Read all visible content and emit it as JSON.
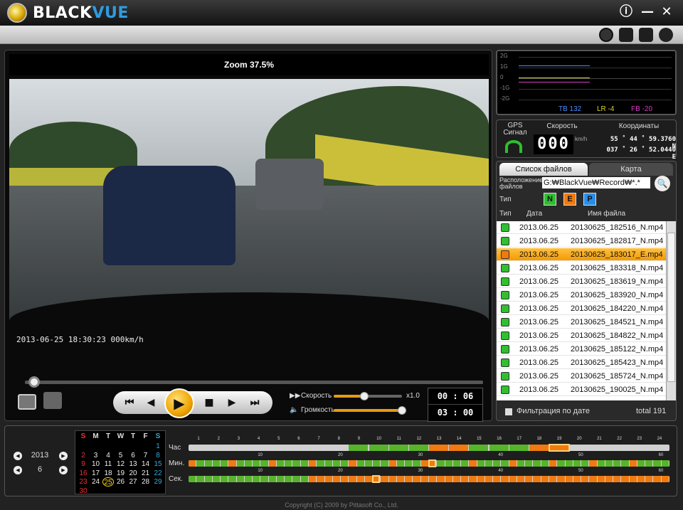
{
  "app": {
    "brand_black": "BLACK",
    "brand_blue": "VUE"
  },
  "window_controls": {
    "info": "ⓘ",
    "minimize": "—",
    "close": "✕"
  },
  "player": {
    "zoom_text": "Zoom 37.5%",
    "osd_text": "2013-06-25 18:30:23  000km/h",
    "seek_progress": 0.02,
    "speed_label": "Скорость",
    "speed_value": "x1.0",
    "speed_level": 0.45,
    "volume_label": "Громкость",
    "volume_level": 1.0,
    "time_current": "00 : 06",
    "time_total": "03 : 00"
  },
  "sensor": {
    "labels": [
      "2G",
      "1G",
      "0",
      "-1G",
      "-2G"
    ],
    "tb_label": "TB 132",
    "lr_label": "LR -4",
    "fb_label": "FB -20",
    "colors": {
      "tb": "#4a8cff",
      "lr": "#d6d62a",
      "fb": "#d040c0"
    }
  },
  "gps": {
    "signal_label": "GPS\nСигнал",
    "speed_label": "Скорость",
    "speed_value": "000",
    "speed_unit": "km/h",
    "coords_label": "Координаты",
    "lat_prefix": "N",
    "lat": "55 ˚ 44 ˚ 59.3760 N",
    "lon_prefix": "E",
    "lon": "037 ˚ 26 ˚ 52.0440 E"
  },
  "files": {
    "tab_list": "Список файлов",
    "tab_map": "Карта",
    "location_label": "Расположение\nфайлов",
    "location_value": "G:₩BlackVue₩Record₩*.*",
    "type_label": "Тип",
    "type_buttons": [
      {
        "label": "N",
        "color": "#2fbf2f"
      },
      {
        "label": "E",
        "color": "#f07a10"
      },
      {
        "label": "P",
        "color": "#2a8ee8"
      }
    ],
    "headers": {
      "type": "Тип",
      "date": "Дата",
      "name": "Имя файла"
    },
    "rows": [
      {
        "date": "2013.06.25",
        "name": "20130625_182516_N.mp4",
        "type": "N"
      },
      {
        "date": "2013.06.25",
        "name": "20130625_182817_N.mp4",
        "type": "N"
      },
      {
        "date": "2013.06.25",
        "name": "20130625_183017_E.mp4",
        "type": "E",
        "selected": true
      },
      {
        "date": "2013.06.25",
        "name": "20130625_183318_N.mp4",
        "type": "N"
      },
      {
        "date": "2013.06.25",
        "name": "20130625_183619_N.mp4",
        "type": "N"
      },
      {
        "date": "2013.06.25",
        "name": "20130625_183920_N.mp4",
        "type": "N"
      },
      {
        "date": "2013.06.25",
        "name": "20130625_184220_N.mp4",
        "type": "N"
      },
      {
        "date": "2013.06.25",
        "name": "20130625_184521_N.mp4",
        "type": "N"
      },
      {
        "date": "2013.06.25",
        "name": "20130625_184822_N.mp4",
        "type": "N"
      },
      {
        "date": "2013.06.25",
        "name": "20130625_185122_N.mp4",
        "type": "N"
      },
      {
        "date": "2013.06.25",
        "name": "20130625_185423_N.mp4",
        "type": "N"
      },
      {
        "date": "2013.06.25",
        "name": "20130625_185724_N.mp4",
        "type": "N"
      },
      {
        "date": "2013.06.25",
        "name": "20130625_190025_N.mp4",
        "type": "N"
      }
    ],
    "filter_label": "Фильтрация по дате",
    "total_label": "total  191"
  },
  "calendar": {
    "year": "2013",
    "month": "6",
    "weekdays": [
      "S",
      "M",
      "T",
      "W",
      "T",
      "F",
      "S"
    ],
    "weeks": [
      [
        "",
        "",
        "",
        "",
        "",
        "",
        "1"
      ],
      [
        "2",
        "3",
        "4",
        "5",
        "6",
        "7",
        "8"
      ],
      [
        "9",
        "10",
        "11",
        "12",
        "13",
        "14",
        "15"
      ],
      [
        "16",
        "17",
        "18",
        "19",
        "20",
        "21",
        "22"
      ],
      [
        "23",
        "24",
        "25",
        "26",
        "27",
        "28",
        "29"
      ],
      [
        "30",
        "",
        "",
        "",
        "",
        "",
        ""
      ]
    ],
    "selected_day": "25"
  },
  "timeline": {
    "hour_label": "Час",
    "min_label": "Мин.",
    "sec_label": "Сек.",
    "hour_ticks": [
      "1",
      "2",
      "3",
      "4",
      "5",
      "6",
      "7",
      "8",
      "9",
      "10",
      "11",
      "12",
      "13",
      "14",
      "15",
      "16",
      "17",
      "18",
      "19",
      "20",
      "21",
      "22",
      "23",
      "24"
    ],
    "min_ticks": [
      "10",
      "20",
      "30",
      "40",
      "50",
      "60"
    ],
    "sec_ticks": [
      "10",
      "20",
      "30",
      "40",
      "50",
      "60"
    ],
    "selected_hour": 18,
    "selected_minute": 30,
    "selected_second": 23
  },
  "footer": {
    "copyright": "Copyright (C) 2009 by Pittasoft Co., Ltd."
  }
}
